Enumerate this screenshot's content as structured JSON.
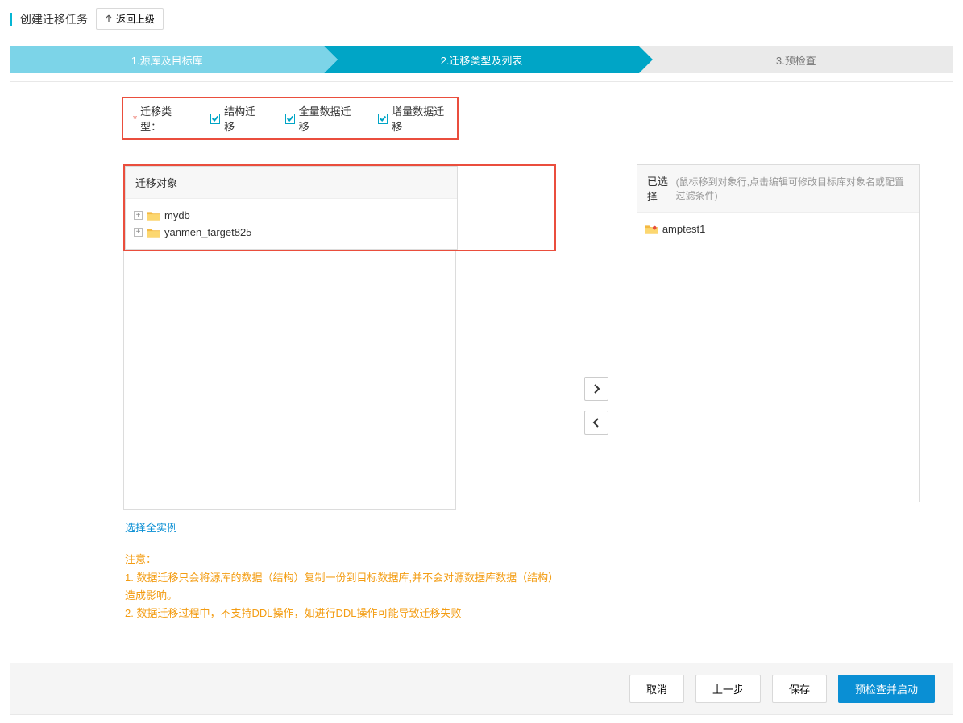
{
  "header": {
    "title": "创建迁移任务",
    "backLabel": "返回上级"
  },
  "steps": {
    "s1": "1.源库及目标库",
    "s2": "2.迁移类型及列表",
    "s3": "3.预检查"
  },
  "typeRow": {
    "label": "迁移类型：",
    "opt1": "结构迁移",
    "opt2": "全量数据迁移",
    "opt3": "增量数据迁移"
  },
  "panels": {
    "leftTitle": "迁移对象",
    "rightTitle": "已选择",
    "rightHint": "(鼠标移到对象行,点击编辑可修改目标库对象名或配置过滤条件)",
    "sourceItems": [
      {
        "name": "mydb"
      },
      {
        "name": "yanmen_target825"
      }
    ],
    "selectedItems": [
      {
        "name": "amptest1"
      }
    ],
    "selectAll": "选择全实例"
  },
  "notes": {
    "title": "注意：",
    "line1": "1. 数据迁移只会将源库的数据（结构）复制一份到目标数据库,并不会对源数据库数据（结构）造成影响。",
    "line2": "2. 数据迁移过程中，不支持DDL操作，如进行DDL操作可能导致迁移失败"
  },
  "footer": {
    "cancel": "取消",
    "prev": "上一步",
    "save": "保存",
    "precheck": "预检查并启动"
  }
}
